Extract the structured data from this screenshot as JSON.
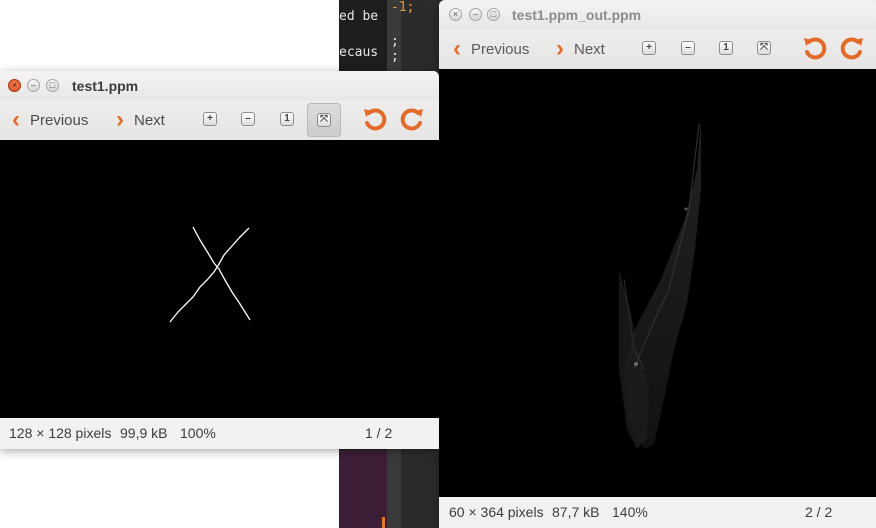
{
  "background_editor": {
    "lines": [
      {
        "text": "ed be",
        "suffix": "-1;"
      },
      {
        "text": "",
        "suffix": ";"
      },
      {
        "text": "ecaus",
        "suffix": ";"
      }
    ]
  },
  "window_left": {
    "title": "test1.ppm",
    "toolbar": {
      "previous_label": "Previous",
      "next_label": "Next"
    },
    "status": {
      "dimensions": "128 × 128 pixels",
      "size": "99,9 kB",
      "zoom": "100%",
      "page": "1 / 2"
    }
  },
  "window_right": {
    "title": "test1.ppm_out.ppm",
    "toolbar": {
      "previous_label": "Previous",
      "next_label": "Next"
    },
    "status": {
      "dimensions": "60 × 364 pixels",
      "size": "87,7 kB",
      "zoom": "140%",
      "page": "2 / 2"
    }
  },
  "icons": {
    "close": "close-icon",
    "minimize": "minimize-icon",
    "maximize": "maximize-icon",
    "previous": "chevron-left-icon",
    "next": "chevron-right-icon",
    "zoom_in": "zoom-in-icon",
    "zoom_out": "zoom-out-icon",
    "normal_size": "normal-size-icon",
    "best_fit": "best-fit-icon",
    "rotate_left": "rotate-left-icon",
    "rotate_right": "rotate-right-icon"
  },
  "colors": {
    "accent": "#e26b2a",
    "viewport": "#000000"
  }
}
